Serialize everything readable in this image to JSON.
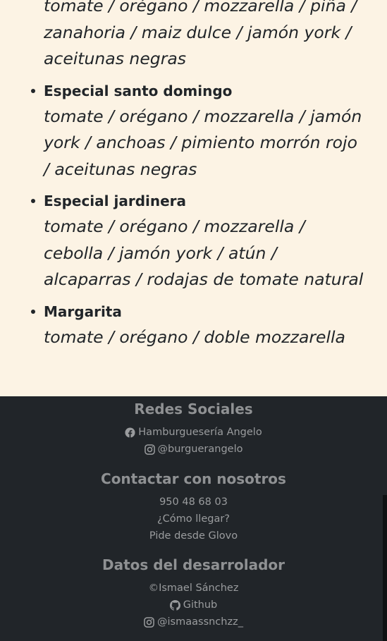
{
  "menu": {
    "items": [
      {
        "name": "",
        "ingredients": "tomate / orégano / mozzarella / piña / zanahoria / maiz dulce / jamón york / aceitunas negras"
      },
      {
        "name": "Especial santo domingo",
        "ingredients": "tomate / orégano / mozzarella / jamón york / anchoas / pimiento morrón rojo / aceitunas negras"
      },
      {
        "name": "Especial jardinera",
        "ingredients": "tomate / orégano / mozzarella / cebolla / jamón york / atún / alcaparras / rodajas de tomate natural"
      },
      {
        "name": "Margarita",
        "ingredients": "tomate / orégano / doble mozzarella"
      }
    ]
  },
  "footer": {
    "social": {
      "title": "Redes Sociales",
      "facebook": {
        "icon": "facebook-icon",
        "label": "Hamburguesería Angelo"
      },
      "instagram": {
        "icon": "instagram-icon",
        "label": "@burguerangelo"
      }
    },
    "contact": {
      "title": "Contactar con nosotros",
      "phone": "950 48 68 03",
      "directions": "¿Cómo llegar?",
      "glovo": "Pide desde Glovo"
    },
    "developer": {
      "title": "Datos del desarrolador",
      "copyright": "©Ismael Sánchez",
      "github": {
        "icon": "github-icon",
        "label": "Github"
      },
      "instagram": {
        "icon": "instagram-icon",
        "label": "@ismaassnchzz_"
      }
    }
  },
  "colors": {
    "menu_background": "#fcf3e4",
    "footer_background": "#212529",
    "footer_text": "#9a9c9e"
  }
}
